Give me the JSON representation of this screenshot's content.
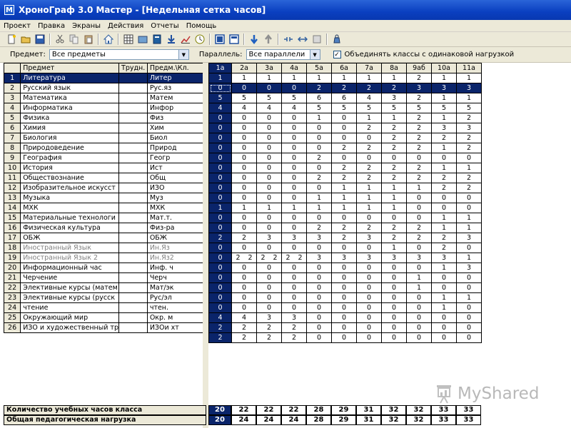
{
  "window": {
    "title": "ХроноГраф 3.0 Мастер - [Недельная сетка часов]",
    "icon_letter": "M"
  },
  "menu": [
    "Проект",
    "Правка",
    "Экраны",
    "Действия",
    "Отчеты",
    "Помощь"
  ],
  "toolbar": {
    "groups": [
      [
        "new-file-icon",
        "open-folder-icon",
        "save-icon"
      ],
      [
        "cut-icon",
        "copy-icon",
        "paste-icon"
      ],
      [
        "home-icon"
      ],
      [
        "grid-icon",
        "folder-icon",
        "book-icon",
        "download-icon",
        "chart-icon",
        "clock-icon"
      ],
      [
        "window-icon",
        "window-alt-icon"
      ],
      [
        "arrow-down-icon",
        "arrow-up-icon"
      ],
      [
        "merge-icon",
        "split-icon",
        "swap-icon"
      ],
      [
        "weight-icon"
      ]
    ]
  },
  "filters": {
    "subject_label": "Предмет:",
    "subject_value": "Все предметы",
    "parallel_label": "Параллель:",
    "parallel_value": "Все параллели",
    "merge_checked": true,
    "merge_label": "Объединять классы с одинаковой нагрузкой"
  },
  "left_headers": {
    "num": "",
    "subject": "Предмет",
    "difficulty": "Трудн.",
    "short": "Предм.\\Кл."
  },
  "class_headers": [
    "1а",
    "2а",
    "3а",
    "4а",
    "5а",
    "6а",
    "7а",
    "8а",
    "9аб",
    "10а",
    "11а"
  ],
  "class_counts": [
    "1",
    "1",
    "1",
    "1",
    "1",
    "1",
    "1",
    "1",
    "2",
    "1",
    "1"
  ],
  "rows": [
    {
      "n": "1",
      "subject": "Литература",
      "short": "Литер",
      "values": [
        "0",
        "0",
        "0",
        "0",
        "2",
        "2",
        "2",
        "2",
        "3",
        "3",
        "3"
      ]
    },
    {
      "n": "2",
      "subject": "Русский язык",
      "short": "Рус.яз",
      "values": [
        "5",
        "5",
        "5",
        "5",
        "6",
        "6",
        "4",
        "3",
        "2",
        "1",
        "1"
      ]
    },
    {
      "n": "3",
      "subject": "Математика",
      "short": "Матем",
      "values": [
        "4",
        "4",
        "4",
        "4",
        "5",
        "5",
        "5",
        "5",
        "5",
        "5",
        "5"
      ]
    },
    {
      "n": "4",
      "subject": "Информатика",
      "short": "Инфор",
      "values": [
        "0",
        "0",
        "0",
        "0",
        "1",
        "0",
        "1",
        "1",
        "2",
        "1",
        "2"
      ]
    },
    {
      "n": "5",
      "subject": "Физика",
      "short": "Физ",
      "values": [
        "0",
        "0",
        "0",
        "0",
        "0",
        "0",
        "2",
        "2",
        "2",
        "3",
        "3"
      ]
    },
    {
      "n": "6",
      "subject": "Химия",
      "short": "Хим",
      "values": [
        "0",
        "0",
        "0",
        "0",
        "0",
        "0",
        "0",
        "2",
        "2",
        "2",
        "2"
      ]
    },
    {
      "n": "7",
      "subject": "Биология",
      "short": "Биол",
      "values": [
        "0",
        "0",
        "0",
        "0",
        "0",
        "2",
        "2",
        "2",
        "2",
        "1",
        "2"
      ]
    },
    {
      "n": "8",
      "subject": "Природоведение",
      "short": "Природ",
      "values": [
        "0",
        "0",
        "0",
        "0",
        "2",
        "0",
        "0",
        "0",
        "0",
        "0",
        "0"
      ]
    },
    {
      "n": "9",
      "subject": "География",
      "short": "Геогр",
      "values": [
        "0",
        "0",
        "0",
        "0",
        "0",
        "2",
        "2",
        "2",
        "2",
        "1",
        "1"
      ]
    },
    {
      "n": "10",
      "subject": "История",
      "short": "Ист",
      "values": [
        "0",
        "0",
        "0",
        "0",
        "2",
        "2",
        "2",
        "2",
        "2",
        "2",
        "2"
      ]
    },
    {
      "n": "11",
      "subject": "Обществознание",
      "short": "Общ",
      "values": [
        "0",
        "0",
        "0",
        "0",
        "0",
        "1",
        "1",
        "1",
        "1",
        "2",
        "2"
      ]
    },
    {
      "n": "12",
      "subject": "Изобразительное искусст",
      "short": "ИЗО",
      "values": [
        "0",
        "0",
        "0",
        "0",
        "1",
        "1",
        "1",
        "1",
        "0",
        "0",
        "0"
      ]
    },
    {
      "n": "13",
      "subject": "Музыка",
      "short": "Муз",
      "values": [
        "1",
        "1",
        "1",
        "1",
        "1",
        "1",
        "1",
        "1",
        "0",
        "0",
        "0"
      ]
    },
    {
      "n": "14",
      "subject": "МХК",
      "short": "МХК",
      "values": [
        "0",
        "0",
        "0",
        "0",
        "0",
        "0",
        "0",
        "0",
        "0",
        "1",
        "1"
      ]
    },
    {
      "n": "15",
      "subject": "Материальные технологи",
      "short": "Мат.т.",
      "values": [
        "0",
        "0",
        "0",
        "0",
        "2",
        "2",
        "2",
        "2",
        "2",
        "1",
        "1"
      ]
    },
    {
      "n": "16",
      "subject": "Физическая культура",
      "short": "Физ-ра",
      "values": [
        "2",
        "2",
        "3",
        "3",
        "3",
        "2",
        "3",
        "2",
        "2",
        "2",
        "3"
      ]
    },
    {
      "n": "17",
      "subject": "ОБЖ",
      "short": "ОБЖ",
      "values": [
        "0",
        "0",
        "0",
        "0",
        "0",
        "0",
        "0",
        "1",
        "0",
        "2",
        "0"
      ]
    },
    {
      "n": "18",
      "subject": "Иностранный Язык",
      "short": "Ин.Яз",
      "gray": true,
      "values": [
        "0",
        "2|2",
        "2|2",
        "2|2",
        "3",
        "3",
        "3",
        "3",
        "3",
        "3",
        "1"
      ]
    },
    {
      "n": "19",
      "subject": "Иностранный Язык 2",
      "short": "Ин.Яз2",
      "gray": true,
      "values": [
        "0",
        "0",
        "0",
        "0",
        "0",
        "0",
        "0",
        "0",
        "0",
        "1",
        "3"
      ]
    },
    {
      "n": "20",
      "subject": "Информационный час",
      "short": "Инф. ч",
      "values": [
        "0",
        "0",
        "0",
        "0",
        "0",
        "0",
        "0",
        "0",
        "1",
        "0",
        "0"
      ]
    },
    {
      "n": "21",
      "subject": "Черчение",
      "short": "Черч",
      "values": [
        "0",
        "0",
        "0",
        "0",
        "0",
        "0",
        "0",
        "0",
        "1",
        "0",
        "0"
      ]
    },
    {
      "n": "22",
      "subject": "Элективные курсы (матем",
      "short": "Мат/эк",
      "values": [
        "0",
        "0",
        "0",
        "0",
        "0",
        "0",
        "0",
        "0",
        "0",
        "1",
        "1"
      ]
    },
    {
      "n": "23",
      "subject": "Элективные курсы (русск",
      "short": "Рус/эл",
      "values": [
        "0",
        "0",
        "0",
        "0",
        "0",
        "0",
        "0",
        "0",
        "0",
        "1",
        "0"
      ]
    },
    {
      "n": "24",
      "subject": "чтение",
      "short": "чтен.",
      "values": [
        "4",
        "4",
        "3",
        "3",
        "0",
        "0",
        "0",
        "0",
        "0",
        "0",
        "0"
      ]
    },
    {
      "n": "25",
      "subject": "Окружающий мир",
      "short": "Окр. м",
      "values": [
        "2",
        "2",
        "2",
        "2",
        "0",
        "0",
        "0",
        "0",
        "0",
        "0",
        "0"
      ]
    },
    {
      "n": "26",
      "subject": "ИЗО и художественный тр",
      "short": "ИЗОи хт",
      "values": [
        "2",
        "2",
        "2",
        "2",
        "0",
        "0",
        "0",
        "0",
        "0",
        "0",
        "0"
      ]
    }
  ],
  "totals": [
    {
      "label": "Количество учебных часов класса",
      "values": [
        "20",
        "22",
        "22",
        "22",
        "28",
        "29",
        "31",
        "32",
        "32",
        "33",
        "33"
      ]
    },
    {
      "label": "Общая педагогическая нагрузка",
      "values": [
        "20",
        "24",
        "24",
        "24",
        "28",
        "29",
        "31",
        "32",
        "32",
        "33",
        "33"
      ]
    }
  ],
  "watermark": "MyShared",
  "colors": {
    "selection": "#0a246a",
    "title_bar": "#0a3fc0",
    "panel": "#ece9d8"
  }
}
